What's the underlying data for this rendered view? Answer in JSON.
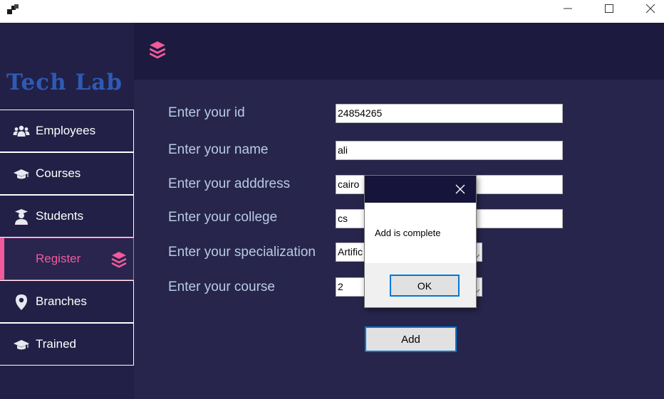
{
  "app": {
    "logo_text": "Tech Lab"
  },
  "titlebar": {
    "icons": [
      "app-icon",
      "minimize-icon",
      "maximize-icon",
      "close-icon"
    ]
  },
  "sidebar": {
    "items": [
      {
        "label": "Employees",
        "icon": "people-icon"
      },
      {
        "label": "Courses",
        "icon": "graduation-cap-icon"
      },
      {
        "label": "Students",
        "icon": "student-icon"
      },
      {
        "label": "Register",
        "icon": "layers-icon",
        "active": true
      },
      {
        "label": "Branches",
        "icon": "location-pin-icon"
      },
      {
        "label": "Trained",
        "icon": "graduation-cap-icon"
      }
    ],
    "active_color": "#f15a9b"
  },
  "form": {
    "fields": [
      {
        "label": "Enter your id",
        "value": "24854265"
      },
      {
        "label": "Enter your name",
        "value": "ali"
      },
      {
        "label": "Enter your adddress",
        "value": "cairo"
      },
      {
        "label": "Enter your college",
        "value": "cs"
      },
      {
        "label": "Enter your specialization",
        "value": "Artific"
      },
      {
        "label": "Enter your course",
        "value": "2"
      }
    ],
    "add_label": "Add"
  },
  "dialog": {
    "message": "Add is complete",
    "ok_label": "OK"
  },
  "colors": {
    "sidebar_bg": "#222046",
    "content_bg": "#27254c",
    "topbar_bg": "#1c1a3f",
    "accent_pink": "#f15a9b",
    "logo_blue": "#2e5ab5",
    "focus_blue": "#0078d7"
  }
}
